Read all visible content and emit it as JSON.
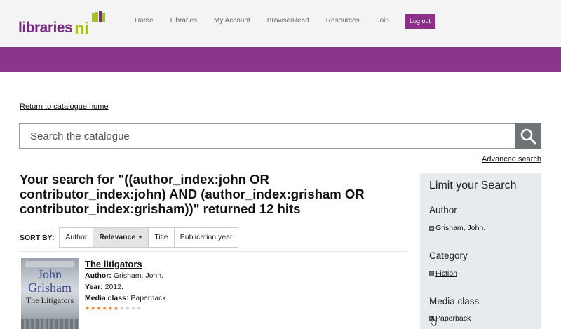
{
  "header": {
    "logo_text": "libraries",
    "logo_suffix": "ni",
    "nav": [
      "Home",
      "Libraries",
      "My Account",
      "Browse/Read",
      "Resources",
      "Join"
    ],
    "logout_label": "Log out"
  },
  "return_link": "Return to catalogue home",
  "search": {
    "placeholder": "Search the catalogue",
    "advanced_label": "Advanced search"
  },
  "results": {
    "heading": "Your search for \"((author_index:john OR contributor_index:john) AND (author_index:grisham OR contributor_index:grisham))\" returned 12 hits"
  },
  "sort": {
    "label": "SORT BY:",
    "options": [
      "Author",
      "Relevance",
      "Title",
      "Publication year"
    ],
    "active": "Relevance"
  },
  "item": {
    "cover_author": "John Grisham",
    "cover_title": "The Litigators",
    "title": "The litigators",
    "author_label": "Author:",
    "author": "Grisham, John.",
    "year_label": "Year:",
    "year": "2012.",
    "media_label": "Media class:",
    "media": "Paperback",
    "rating": 0.6
  },
  "sidebar": {
    "title": "Limit your Search",
    "sections": [
      {
        "heading": "Author",
        "link": "Grisham, John."
      },
      {
        "heading": "Category",
        "link": "Fiction"
      },
      {
        "heading": "Media class",
        "link": "Paperback"
      }
    ]
  },
  "colors": {
    "brand_purple": "#8b348d",
    "brand_green": "#a8c41a",
    "star_on": "#f07b1a",
    "star_off": "#c8c8c8"
  }
}
